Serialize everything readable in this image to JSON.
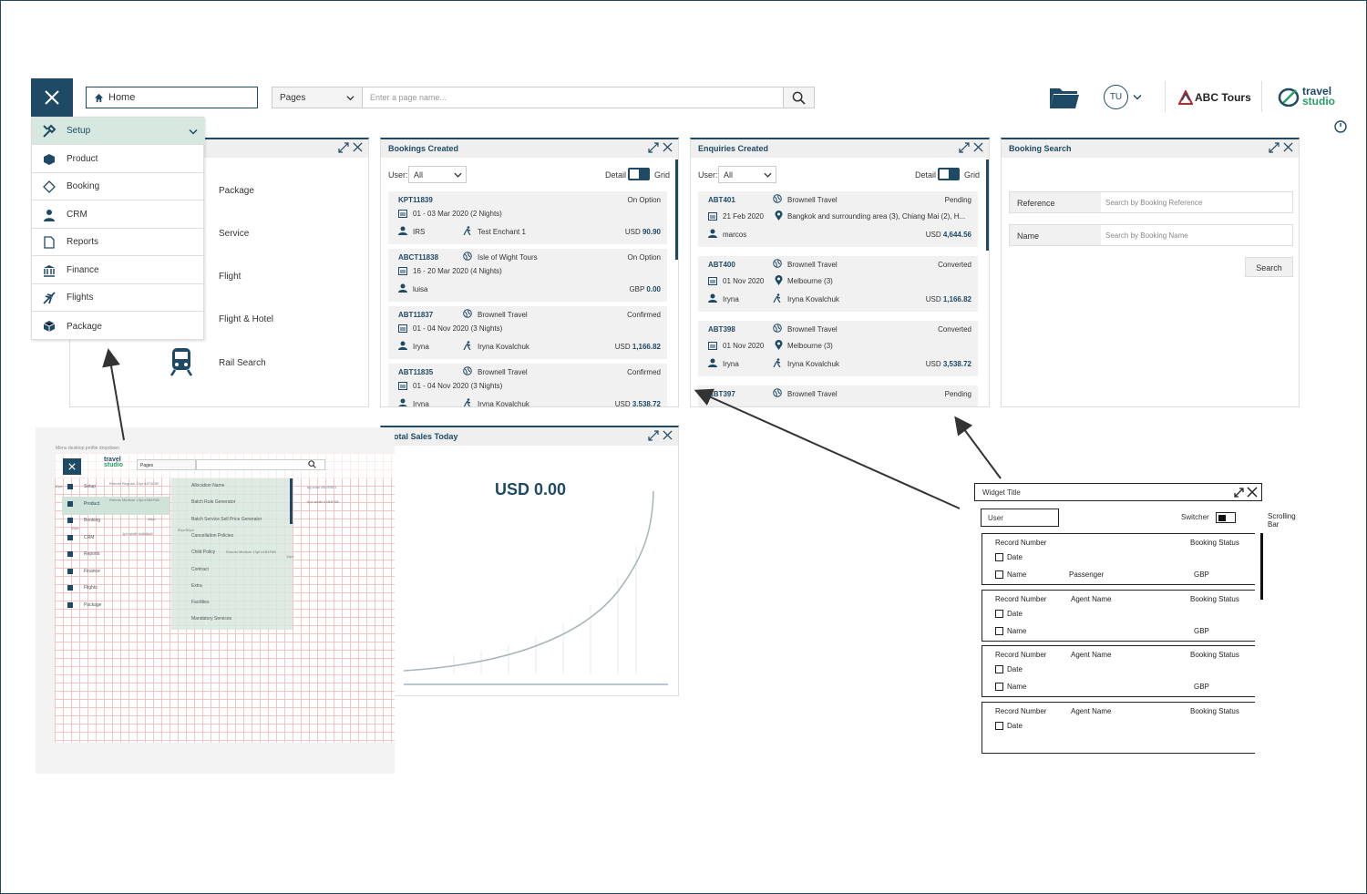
{
  "header": {
    "home_label": "Home",
    "pages_label": "Pages",
    "search_placeholder": "Enter a page name...",
    "user_initials": "TU",
    "company": "ABC Tours",
    "logo_line1": "travel",
    "logo_line2": "studio"
  },
  "sidebar": {
    "items": [
      {
        "label": "Setup"
      },
      {
        "label": "Product"
      },
      {
        "label": "Booking"
      },
      {
        "label": "CRM"
      },
      {
        "label": "Reports"
      },
      {
        "label": "Finance"
      },
      {
        "label": "Flights"
      },
      {
        "label": "Package"
      }
    ]
  },
  "product_widget": {
    "items": [
      "Package",
      "Service",
      "Flight",
      "Flight & Hotel",
      "Rail Search"
    ]
  },
  "bookings": {
    "title": "Bookings Created",
    "user_label": "User:",
    "user_value": "All",
    "detail_label": "Detail",
    "grid_label": "Grid",
    "records": [
      {
        "ref": "KPT11839",
        "status": "On Option",
        "agent": "",
        "dates": "01 - 03 Mar 2020 (2 Nights)",
        "lead": "IRS",
        "passenger": "Test Enchant 1",
        "price_cur": "USD",
        "price": "90.90"
      },
      {
        "ref": "ABCT11838",
        "status": "On Option",
        "agent": "Isle of Wight Tours",
        "dates": "16 - 20 Mar 2020 (4 Nights)",
        "lead": "luisa",
        "passenger": "",
        "price_cur": "GBP",
        "price": "0.00"
      },
      {
        "ref": "ABT11837",
        "status": "Confirmed",
        "agent": "Brownell Travel",
        "dates": "01 - 04 Nov 2020 (3 Nights)",
        "lead": "Iryna",
        "passenger": "Iryna Kovalchuk",
        "price_cur": "USD",
        "price": "1,166.82"
      },
      {
        "ref": "ABT11835",
        "status": "Confirmed",
        "agent": "Brownell Travel",
        "dates": "01 - 04 Nov 2020 (3 Nights)",
        "lead": "Iryna",
        "passenger": "Iryna Kovalchuk",
        "price_cur": "USD",
        "price": "3,538.72"
      }
    ]
  },
  "enquiries": {
    "title": "Enquiries Created",
    "user_label": "User:",
    "user_value": "All",
    "detail_label": "Detail",
    "grid_label": "Grid",
    "records": [
      {
        "ref": "ABT401",
        "status": "Pending",
        "agent": "Brownell Travel",
        "date": "21 Feb 2020",
        "location": "Bangkok and surrounding area (3), Chiang Mai (2), H...",
        "lead": "marcos",
        "passenger": "",
        "price_cur": "USD",
        "price": "4,644.56"
      },
      {
        "ref": "ABT400",
        "status": "Converted",
        "agent": "Brownell Travel",
        "date": "01 Nov 2020",
        "location": "Melbourne (3)",
        "lead": "Iryna",
        "passenger": "Iryna Kovalchuk",
        "price_cur": "USD",
        "price": "1,166.82"
      },
      {
        "ref": "ABT398",
        "status": "Converted",
        "agent": "Brownell Travel",
        "date": "01 Nov 2020",
        "location": "Melbourne (3)",
        "lead": "Iryna",
        "passenger": "Iryna Kovalchuk",
        "price_cur": "USD",
        "price": "3,538.72"
      },
      {
        "ref": "ABT397",
        "status": "Pending",
        "agent": "Brownell Travel",
        "date": "",
        "location": "",
        "lead": "",
        "passenger": "",
        "price_cur": "",
        "price": ""
      }
    ]
  },
  "booking_search": {
    "title": "Booking Search",
    "reference_label": "Reference",
    "reference_placeholder": "Search by Booking Reference",
    "name_label": "Name",
    "name_placeholder": "Search by Booking Name",
    "search_button": "Search"
  },
  "sales": {
    "title": "otal Sales Today",
    "total": "USD 0.00"
  },
  "grid_mock": {
    "caption": "Menu desktop profile dropdown",
    "pages_label": "Pages",
    "logo_line1": "travel",
    "logo_line2": "studio",
    "menu": [
      "Setup",
      "Product",
      "Booking",
      "CRM",
      "Reports",
      "Finance",
      "Flights",
      "Package"
    ],
    "submenu": [
      "Allocation Name",
      "Batch Rule Generator",
      "Batch Service Sell Price Generator",
      "Cancellation Policies",
      "Child Policy",
      "Contract",
      "Extra",
      "Facilities",
      "Mandatory Services"
    ],
    "annotations": [
      "Roboto Regular 13pt #1F4C6F",
      "Roboto Medium 13pt #1B4F6B",
      "bg color #E2E5E1",
      "5px width #1B4F6B",
      "1px width #d6d6d6",
      "Roboto Medium 13pt #1B4F6B",
      "40px",
      "50px",
      "10px",
      "10px",
      "11px",
      "50px"
    ]
  },
  "wireframe": {
    "title": "Widget Title",
    "user": "User",
    "switcher": "Switcher",
    "scroll_note": "Scrolling Bar",
    "rows": [
      {
        "record": "Record Number",
        "agent": "",
        "status": "Booking Status",
        "date": "Date",
        "name": "Name",
        "passenger": "Passenger",
        "currency": "GBP"
      },
      {
        "record": "Record Number",
        "agent": "Agent Name",
        "status": "Booking Status",
        "date": "Date",
        "name": "Name",
        "passenger": "",
        "currency": "GBP"
      },
      {
        "record": "Record Number",
        "agent": "Agent Name",
        "status": "Booking Status",
        "date": "Date",
        "name": "Name",
        "passenger": "",
        "currency": "GBP"
      },
      {
        "record": "Record Number",
        "agent": "Agent Name",
        "status": "Booking Status",
        "date": "Date",
        "name": "",
        "passenger": "",
        "currency": ""
      }
    ]
  },
  "colors": {
    "primary": "#1f4a66",
    "option": "#f0a020",
    "confirmed": "#3aa070",
    "brand_green": "#2a9d6a",
    "sidebar_active": "#d6e8df"
  }
}
